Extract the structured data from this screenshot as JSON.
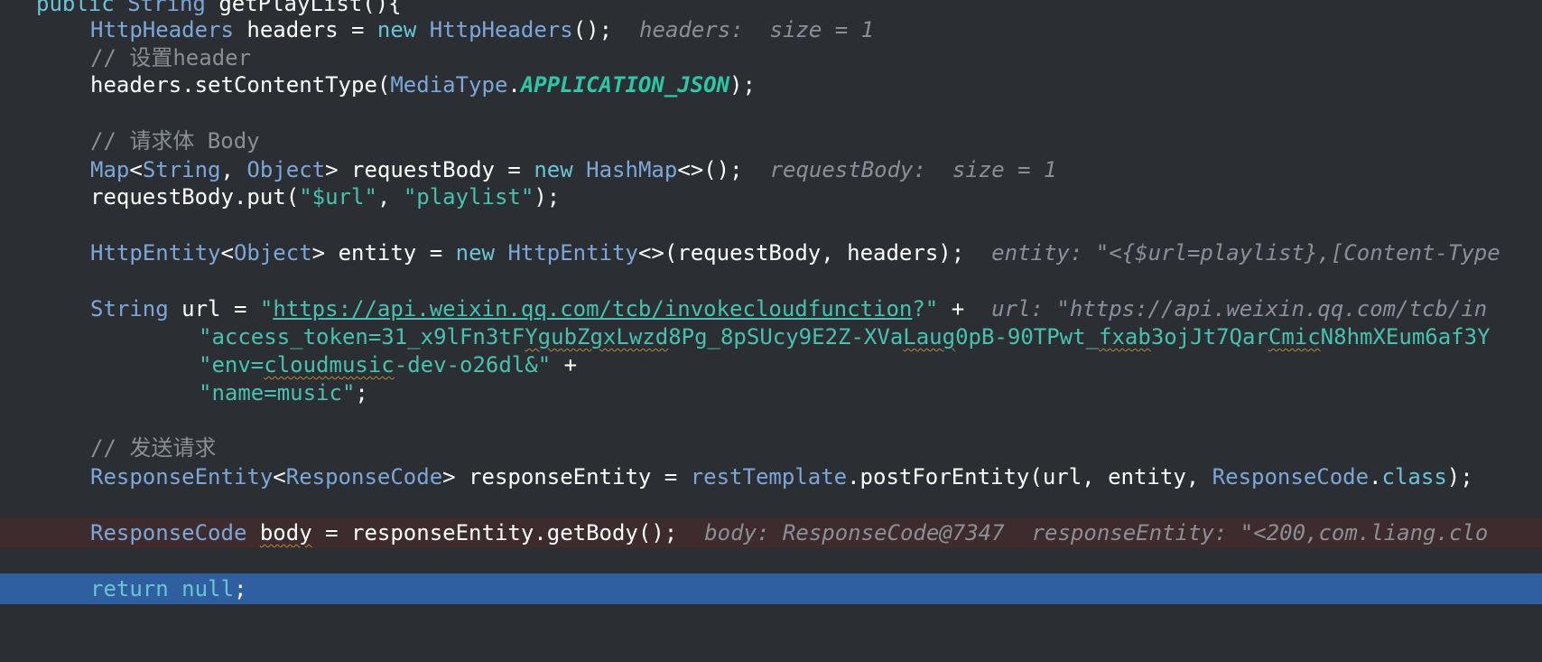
{
  "code": {
    "line0": {
      "kw_public": "public",
      "type_string": "String",
      "method": "getPlayList",
      "tail": "(){"
    },
    "line1": {
      "type": "HttpHeaders",
      "var": "headers",
      "eq": " = ",
      "kw_new": "new",
      "ctor": "HttpHeaders",
      "tail": "();",
      "hint": "headers:  size = 1"
    },
    "line2": {
      "comment": "// 设置header"
    },
    "line3": {
      "obj": "headers",
      "call": ".setContentType(",
      "type": "MediaType",
      "dot": ".",
      "const": "APPLICATION_JSON",
      "tail": ");"
    },
    "line5": {
      "comment": "// 请求体 Body"
    },
    "line6": {
      "type_map": "Map",
      "lt": "<",
      "type_string": "String",
      "comma": ", ",
      "type_object": "Object",
      "gt": "> ",
      "var": "requestBody",
      "eq": " = ",
      "kw_new": "new",
      "ctor": "HashMap",
      "tail": "<>();",
      "hint": "requestBody:  size = 1"
    },
    "line7": {
      "obj": "requestBody",
      "call": ".put(",
      "arg1": "\"$url\"",
      "comma": ", ",
      "arg2": "\"playlist\"",
      "tail": ");"
    },
    "line9": {
      "type": "HttpEntity",
      "lt": "<",
      "type_object": "Object",
      "gt": "> ",
      "var": "entity",
      "eq": " = ",
      "kw_new": "new",
      "ctor": "HttpEntity",
      "tail": "<>(requestBody, headers);",
      "hint": "entity: \"<{$url=playlist},[Content-Type"
    },
    "line11": {
      "type": "String",
      "var": "url",
      "eq": " = ",
      "quote_open": "\"",
      "url": "https://api.weixin.qq.com/tcb/invokecloudfunction",
      "quote_close": "?\"",
      "plus": " +",
      "hint": "url: \"https://api.weixin.qq.com/tcb/in"
    },
    "line12": {
      "str_a": "\"access_token=31_x9lFn3tF",
      "str_b": "YgubZgxLwzd",
      "str_c": "8Pg_8pSUcy9E2Z-XVa",
      "str_d": "Laug",
      "str_e": "0pB-90TPwt_",
      "str_f": "fxab",
      "str_g": "3ojJt7Qar",
      "str_h": "Cmic",
      "str_i": "N8hmXEum6af3Y"
    },
    "line13": {
      "str_a": "\"env=",
      "str_b": "cloudmusic",
      "str_c": "-dev-o26dl&\"",
      "plus": " +"
    },
    "line14": {
      "str": "\"name=music\"",
      "tail": ";"
    },
    "line16": {
      "comment": "// 发送请求"
    },
    "line17": {
      "type": "ResponseEntity",
      "lt": "<",
      "type_inner": "ResponseCode",
      "gt": "> ",
      "var": "responseEntity",
      "eq": " = ",
      "field": "restTemplate",
      "call": ".postForEntity(url, entity, ",
      "cls": "ResponseCode",
      "dot": ".",
      "kw_class": "class",
      "tail": ");"
    },
    "line19": {
      "type": "ResponseCode",
      "var": "body",
      "eq": " = ",
      "call": "responseEntity.getBody();",
      "hint1": "body: ResponseCode@7347",
      "hint2": "responseEntity: \"<200,com.liang.clo"
    },
    "line21": {
      "kw_return": "return",
      "kw_null": "null",
      "tail": ";"
    }
  },
  "colors": {
    "background": "#2b2f33",
    "keyword": "#6bc4d6",
    "type": "#7ca7d8",
    "string": "#48c1b0",
    "constant": "#2dc7a8",
    "comment": "#8a8f94",
    "hint": "#8c9096",
    "breakpoint_line": "#3d2b2d",
    "execution_line": "#2f5f9e"
  }
}
